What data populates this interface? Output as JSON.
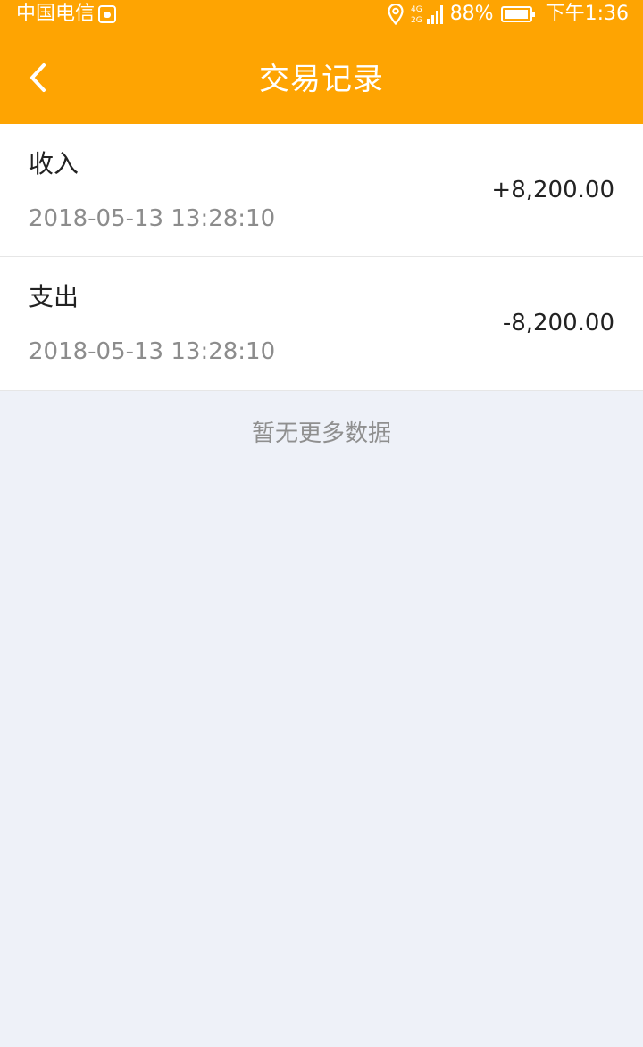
{
  "status_bar": {
    "carrier": "中国电信",
    "network_top": "4G",
    "network_bottom": "2G",
    "battery_percent": "88%",
    "time": "下午1:36"
  },
  "header": {
    "title": "交易记录",
    "back_icon": "chevron-left-icon",
    "background_color": "#fea402"
  },
  "transactions": [
    {
      "type": "收入",
      "time": "2018-05-13 13:28:10",
      "amount": "+8,200.00"
    },
    {
      "type": "支出",
      "time": "2018-05-13 13:28:10",
      "amount": "-8,200.00"
    }
  ],
  "footer": {
    "no_more_text": "暂无更多数据"
  }
}
